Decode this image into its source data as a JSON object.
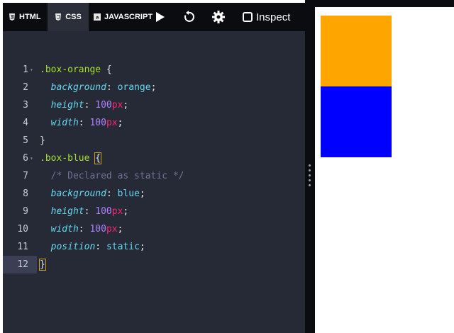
{
  "tabs": [
    {
      "label": "HTML",
      "icon": "html5-icon",
      "active": false
    },
    {
      "label": "CSS",
      "icon": "css3-icon",
      "active": true
    },
    {
      "label": "JAVASCRIPT",
      "icon": "js-icon",
      "active": false
    }
  ],
  "toolbar": {
    "run_icon": "play-icon",
    "reset_icon": "reset-icon",
    "settings_icon": "gear-icon",
    "inspect_label": "Inspect"
  },
  "code_lines": [
    {
      "n": "1",
      "text": ".box-orange {"
    },
    {
      "n": "2",
      "text": "  background: orange;"
    },
    {
      "n": "3",
      "text": "  height: 100px;"
    },
    {
      "n": "4",
      "text": "  width: 100px;"
    },
    {
      "n": "5",
      "text": "}"
    },
    {
      "n": "6",
      "text": ".box-blue {"
    },
    {
      "n": "7",
      "text": "  /* Declared as static */"
    },
    {
      "n": "8",
      "text": "  background: blue;"
    },
    {
      "n": "9",
      "text": "  height: 100px;"
    },
    {
      "n": "10",
      "text": "  width: 100px;"
    },
    {
      "n": "11",
      "text": "  position: static;"
    },
    {
      "n": "12",
      "text": "}"
    }
  ],
  "active_line": "12",
  "preview": {
    "boxes": [
      {
        "name": "box-orange",
        "color": "#ffa500"
      },
      {
        "name": "box-blue",
        "color": "#0000ff"
      }
    ]
  }
}
